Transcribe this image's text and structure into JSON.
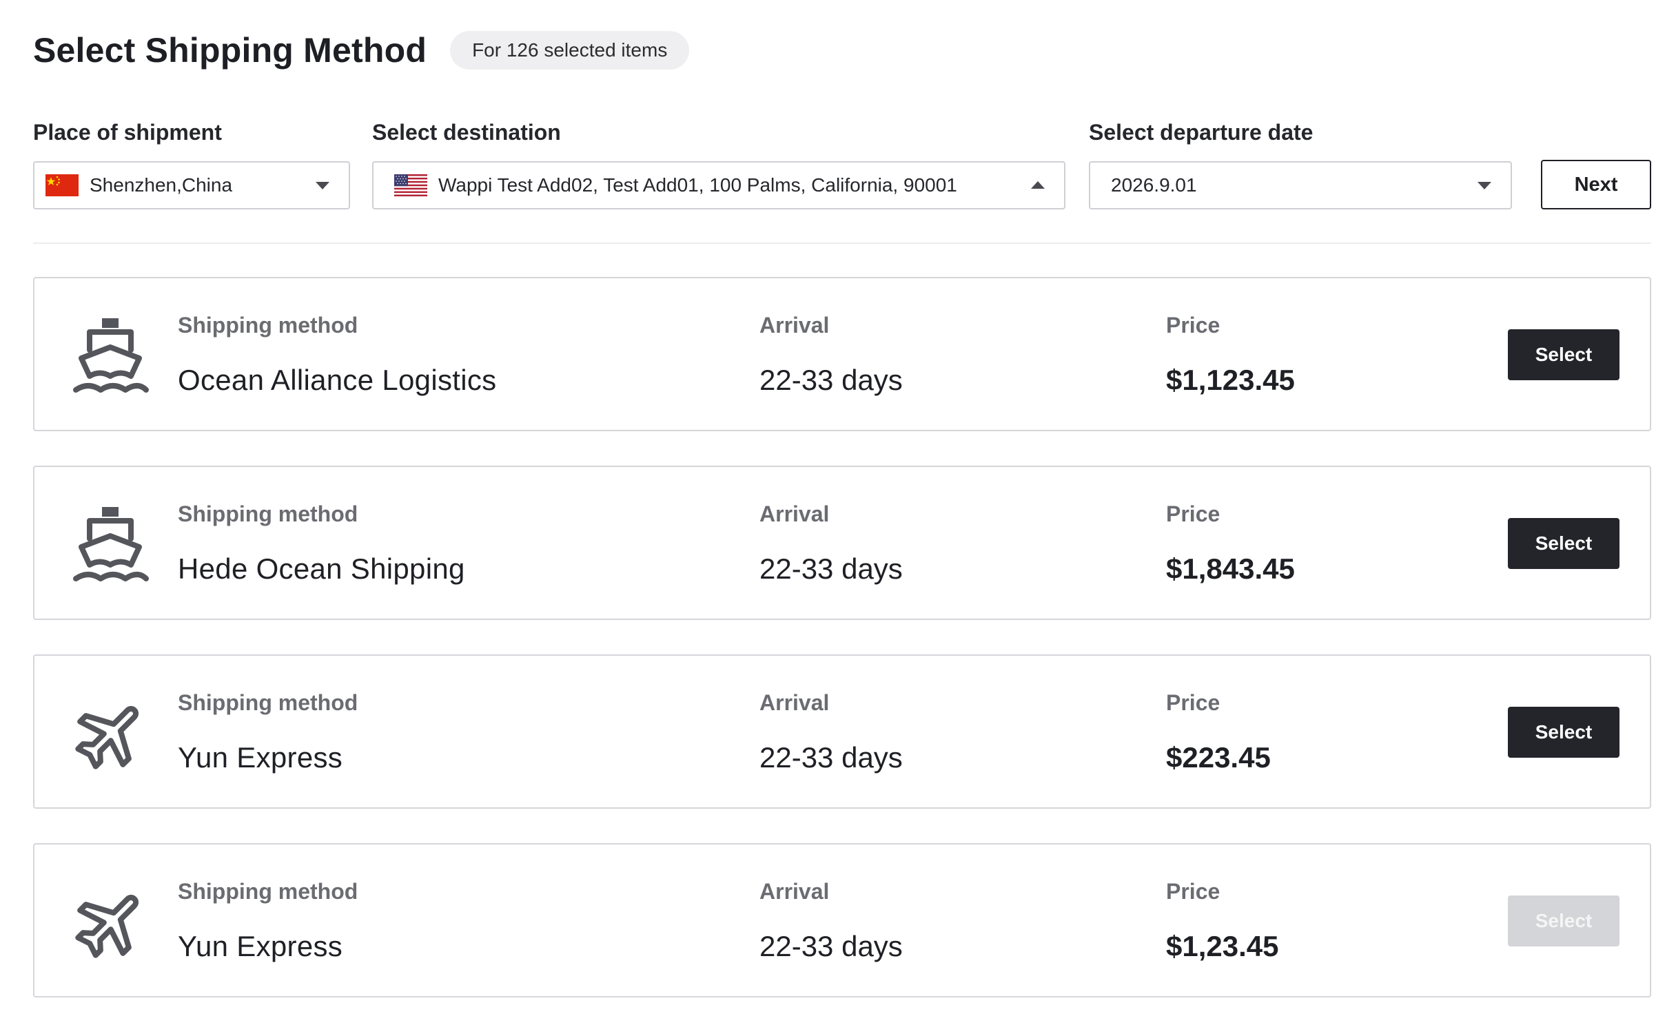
{
  "header": {
    "title": "Select Shipping Method",
    "badge": "For 126 selected items"
  },
  "filters": {
    "origin": {
      "label": "Place of shipment",
      "value": "Shenzhen,China",
      "flag": "china-flag-icon"
    },
    "destination": {
      "label": "Select destination",
      "value": "Wappi Test Add02, Test Add01, 100 Palms, California, 90001",
      "flag": "usa-flag-icon"
    },
    "departure": {
      "label": "Select departure date",
      "value": "2026.9.01"
    },
    "next_label": "Next"
  },
  "columns": {
    "method": "Shipping method",
    "arrival": "Arrival",
    "price": "Price"
  },
  "options": [
    {
      "icon": "ship-icon",
      "method": "Ocean Alliance Logistics",
      "arrival": "22-33 days",
      "price": "$1,123.45",
      "button": "Select",
      "enabled": true
    },
    {
      "icon": "ship-icon",
      "method": "Hede Ocean Shipping",
      "arrival": "22-33 days",
      "price": "$1,843.45",
      "button": "Select",
      "enabled": true
    },
    {
      "icon": "airplane-icon",
      "method": "Yun Express",
      "arrival": "22-33 days",
      "price": "$223.45",
      "button": "Select",
      "enabled": true
    },
    {
      "icon": "airplane-icon",
      "method": "Yun Express",
      "arrival": "22-33 days",
      "price": "$1,23.45",
      "button": "Select",
      "enabled": false
    }
  ],
  "colors": {
    "primary_button": "#24252b",
    "disabled_button": "#d4d5d8",
    "border": "#d5d6da",
    "muted_text": "#6b6c72"
  }
}
